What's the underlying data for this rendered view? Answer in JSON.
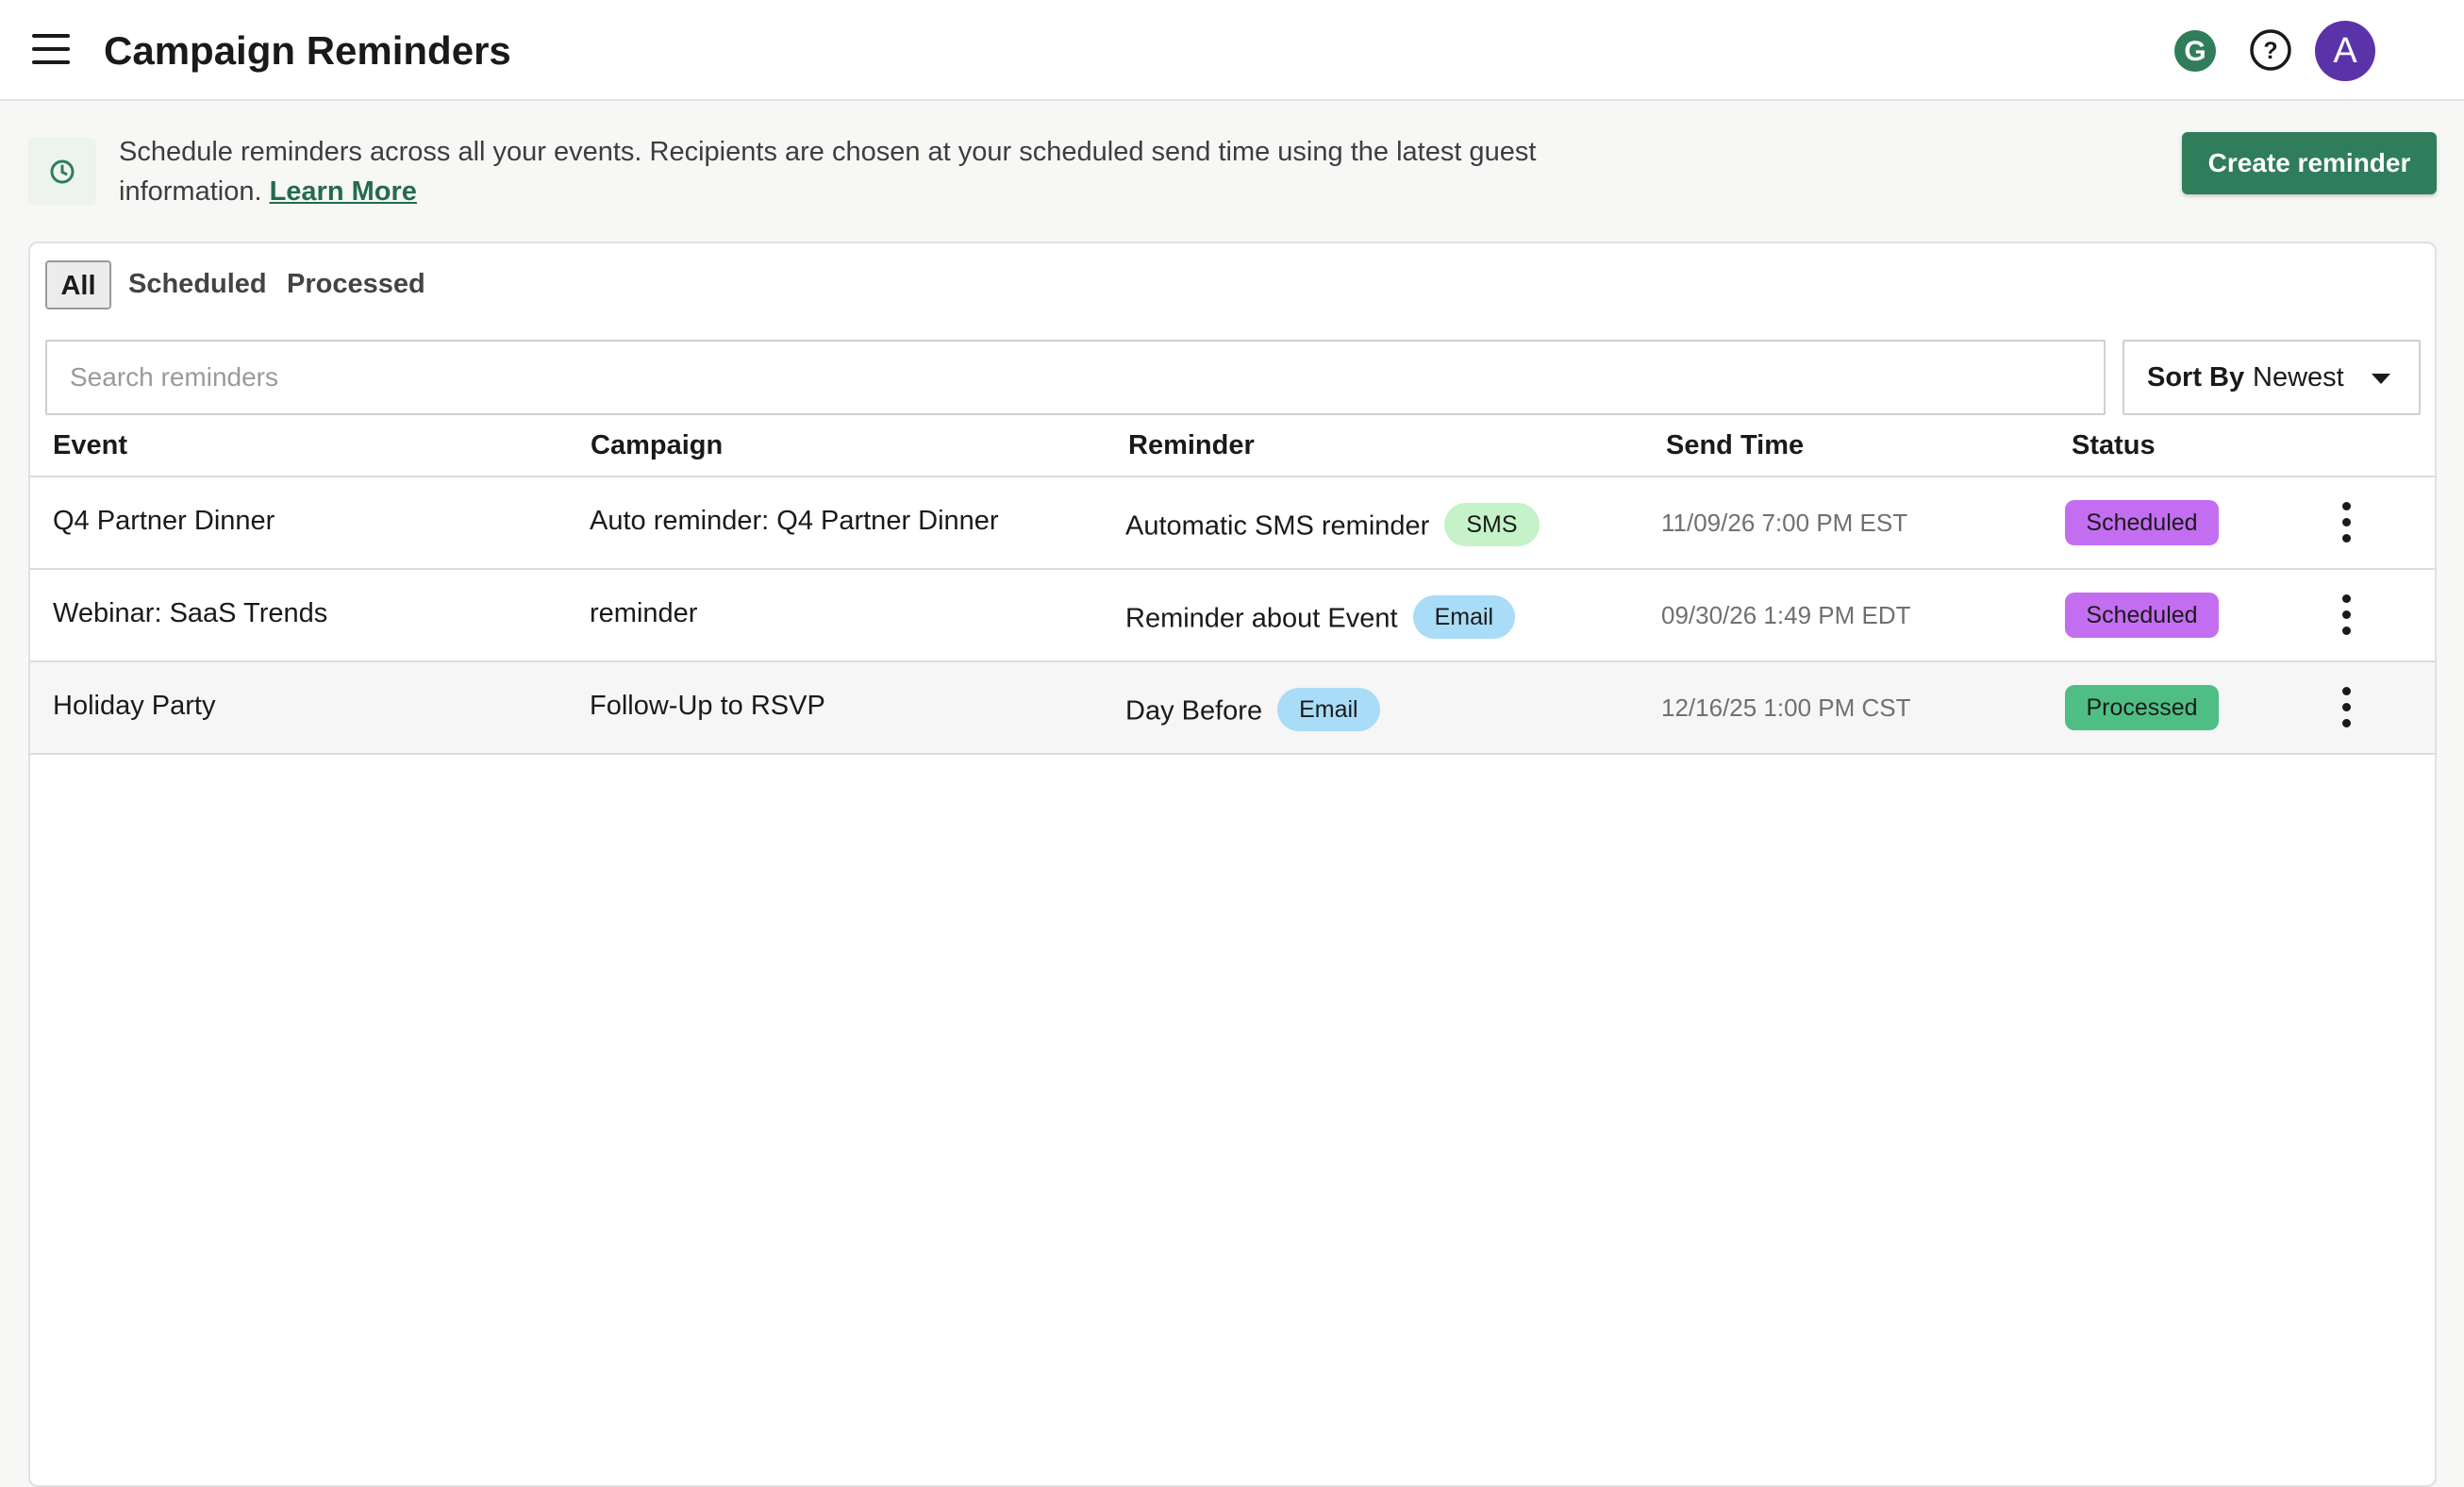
{
  "header": {
    "title": "Campaign Reminders",
    "g_initial": "G",
    "help_symbol": "?",
    "avatar_initial": "A",
    "avatar_color": "#5b33a8",
    "g_color": "#2f7d5b"
  },
  "info": {
    "text": "Schedule reminders across all your events. Recipients are chosen at your scheduled send time using the latest guest information.",
    "learn_more": "Learn More",
    "create_button": "Create reminder",
    "accent_color": "#2f7d5b"
  },
  "tabs": [
    {
      "label": "All",
      "selected": true
    },
    {
      "label": "Scheduled",
      "selected": false
    },
    {
      "label": "Processed",
      "selected": false
    }
  ],
  "search": {
    "placeholder": "Search reminders",
    "value": ""
  },
  "sort": {
    "label": "Sort By",
    "value": "Newest"
  },
  "table": {
    "columns": [
      "Event",
      "Campaign",
      "Reminder",
      "Send Time",
      "Status"
    ],
    "rows": [
      {
        "event": "Q4 Partner Dinner",
        "campaign": "Auto reminder: Q4 Partner Dinner",
        "reminder": "Automatic SMS reminder",
        "channel": "SMS",
        "send_time": "11/09/26 7:00 PM EST",
        "status": "Scheduled"
      },
      {
        "event": "Webinar: SaaS Trends",
        "campaign": "reminder",
        "reminder": "Reminder about Event",
        "channel": "Email",
        "send_time": "09/30/26 1:49 PM EDT",
        "status": "Scheduled"
      },
      {
        "event": "Holiday Party",
        "campaign": "Follow-Up to RSVP",
        "reminder": "Day Before",
        "channel": "Email",
        "send_time": "12/16/25 1:00 PM CST",
        "status": "Processed"
      }
    ]
  },
  "colors": {
    "status_scheduled": "#c36ef0",
    "status_processed": "#4fbe85",
    "chip_sms": "#c5f2c8",
    "chip_email": "#a9dcf7"
  },
  "icons": [
    "menu-icon",
    "grammarly-icon",
    "help-icon",
    "clock-icon",
    "caret-down-icon",
    "more-vert-icon"
  ]
}
